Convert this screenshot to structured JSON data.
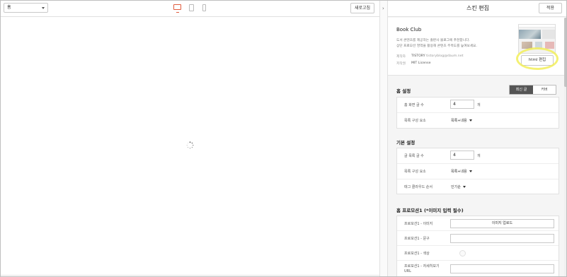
{
  "preview": {
    "page_select": "홈",
    "refresh_label": "새로고침"
  },
  "panel": {
    "title": "스킨 편집",
    "apply_label": "적용"
  },
  "skin": {
    "name": "Book Club",
    "desc_line1": "도서 콘텐츠를 제공하는 출판사 블로그에 추천합니다.",
    "desc_line2": "상단 프로모션 영역을 활용해 콘텐츠 주목도를 높여보세요.",
    "maker_label": "제작자",
    "maker_value": "TISTORY",
    "maker_email": "tistoryblog@daum.net",
    "license_label": "저작권",
    "license_value": "MIT License",
    "html_edit_label": "html 편집"
  },
  "home_settings": {
    "title": "홈 설정",
    "seg_on": "최신 글",
    "seg_off": "커버",
    "rows": {
      "post_count_label": "홈 화면 글 수",
      "post_count_value": "4",
      "post_count_unit": "개",
      "list_layout_label": "목록 구성 요소",
      "list_layout_value": "목록+내용"
    }
  },
  "basic_settings": {
    "title": "기본 설정",
    "rows": {
      "list_count_label": "글 목록 글 수",
      "list_count_value": "4",
      "list_count_unit": "개",
      "list_layout_label": "목록 구성 요소",
      "list_layout_value": "목록+내용",
      "tag_order_label": "태그 클라우드 순서",
      "tag_order_value": "인기순"
    }
  },
  "promo": {
    "title": "홈 프로모션1 (*이미지 입력 필수)",
    "rows": {
      "image_label": "프로모션1 - 이미지",
      "upload_label": "이미지 업로드",
      "text_label": "프로모션1 - 문구",
      "color_label": "프로모션1 - 색상",
      "link_label": "프로모션1 - 자세히보기 URL"
    }
  },
  "colors": {
    "accent": "#e05b3d",
    "highlight": "#f2ef5a",
    "segment_active": "#555555"
  }
}
